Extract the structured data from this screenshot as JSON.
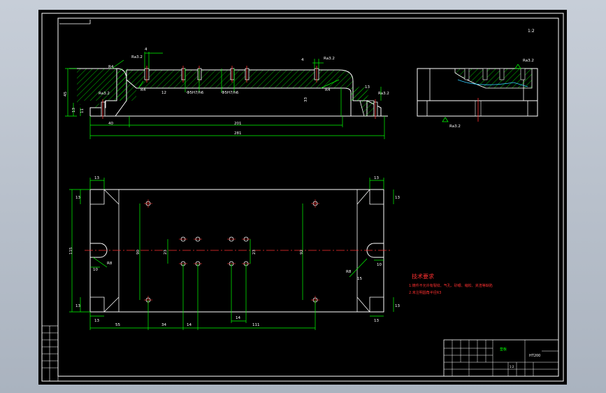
{
  "drawing": {
    "colors": {
      "geometry": "#ffffff",
      "dimension": "#00ff00",
      "hatch": "#00ff00",
      "center": "#ff3030",
      "note": "#ff3030",
      "background": "#000000",
      "pale_bg": "#bcc4cf"
    },
    "top_view": {
      "dim_4_left": "4",
      "dim_4_right": "4",
      "roughness_1": "Ra3.2",
      "roughness_2": "Ra3.2",
      "roughness_3": "Ra3.2",
      "roughness_4": "Ra3.2",
      "r4_a": "R4",
      "r4_b": "R4",
      "r4_c": "R4",
      "dim_12": "12",
      "dim_phi_a": "Φ5H7/h6",
      "dim_phi_b": "Φ5H7/h6",
      "dim_45": "45",
      "dim_13_a": "13",
      "dim_11": "11",
      "dim_33": "33",
      "dim_13_b": "13",
      "dim_40": "40",
      "dim_201": "201",
      "dim_281": "281"
    },
    "side_view": {
      "roughness_top": "Ra3.2",
      "roughness_bottom": "Ra3.2"
    },
    "plan_view": {
      "dim_13_tl": "13",
      "dim_13_tl_v": "13",
      "dim_13_tr": "13",
      "dim_13_tr_v": "13",
      "dim_13_bl": "13",
      "dim_13_bl_v": "13",
      "dim_13_br": "13",
      "dim_13_br_v": "13",
      "dim_115": "115",
      "dim_90": "90",
      "dim_23_a": "23",
      "dim_23_b": "23",
      "dim_92": "92",
      "dim_r8": "R8",
      "dim_10_l": "10",
      "dim_r8_r": "R8",
      "dim_15": "15",
      "dim_10_r": "10",
      "dim_55": "55",
      "dim_34": "34",
      "dim_14_a": "14",
      "dim_14_b": "14",
      "dim_111": "111"
    },
    "tech_req": {
      "title": "技术要求",
      "line1": "1.铸件不允许有裂纹、气孔、砂眼、缩松、夹渣等缺陷",
      "line2": "2.未注明圆角半径R3"
    },
    "scale_note": "1:2",
    "title_block": {
      "part_name": "垫板",
      "material": "HT200",
      "count": "1:2"
    }
  }
}
